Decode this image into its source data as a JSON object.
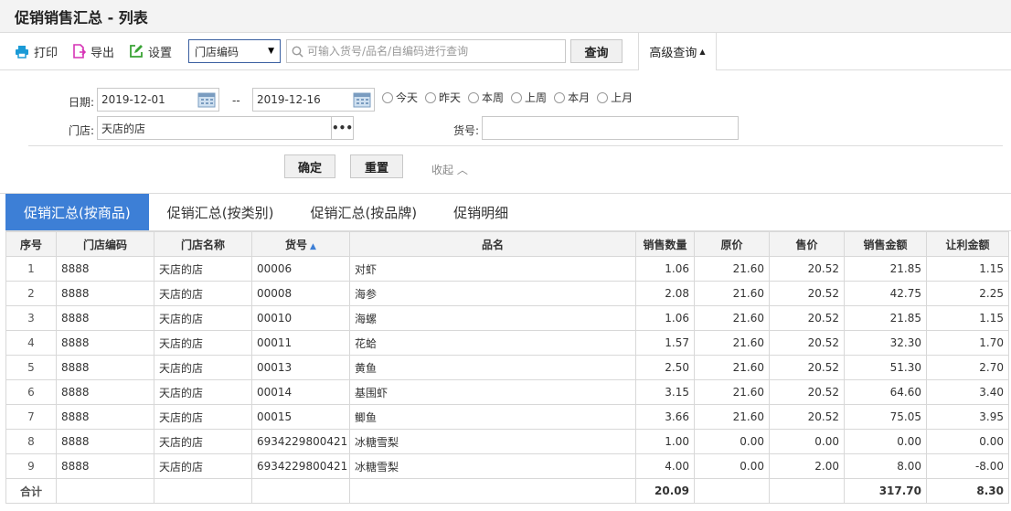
{
  "title": "促销销售汇总 - 列表",
  "toolbar": {
    "print": "打印",
    "export": "导出",
    "settings": "设置",
    "select_value": "门店编码",
    "search_placeholder": "可输入货号/品名/自编码进行查询",
    "query": "查询",
    "advanced": "高级查询"
  },
  "filter": {
    "date_label": "日期:",
    "date_from": "2019-12-01",
    "date_sep": "--",
    "date_to": "2019-12-16",
    "quick": [
      "今天",
      "昨天",
      "本周",
      "上周",
      "本月",
      "上月"
    ],
    "store_label": "门店:",
    "store_value": "天店的店",
    "sku_label": "货号:",
    "sku_value": "",
    "ok": "确定",
    "reset": "重置",
    "collapse": "收起"
  },
  "tabs": [
    "促销汇总(按商品)",
    "促销汇总(按类别)",
    "促销汇总(按品牌)",
    "促销明细"
  ],
  "table": {
    "headers": [
      "序号",
      "门店编码",
      "门店名称",
      "货号",
      "品名",
      "销售数量",
      "原价",
      "售价",
      "销售金额",
      "让利金额"
    ],
    "rows": [
      [
        "1",
        "8888",
        "天店的店",
        "00006",
        "对虾",
        "1.06",
        "21.60",
        "20.52",
        "21.85",
        "1.15"
      ],
      [
        "2",
        "8888",
        "天店的店",
        "00008",
        "海参",
        "2.08",
        "21.60",
        "20.52",
        "42.75",
        "2.25"
      ],
      [
        "3",
        "8888",
        "天店的店",
        "00010",
        "海螺",
        "1.06",
        "21.60",
        "20.52",
        "21.85",
        "1.15"
      ],
      [
        "4",
        "8888",
        "天店的店",
        "00011",
        "花蛤",
        "1.57",
        "21.60",
        "20.52",
        "32.30",
        "1.70"
      ],
      [
        "5",
        "8888",
        "天店的店",
        "00013",
        "黄鱼",
        "2.50",
        "21.60",
        "20.52",
        "51.30",
        "2.70"
      ],
      [
        "6",
        "8888",
        "天店的店",
        "00014",
        "基围虾",
        "3.15",
        "21.60",
        "20.52",
        "64.60",
        "3.40"
      ],
      [
        "7",
        "8888",
        "天店的店",
        "00015",
        "鲫鱼",
        "3.66",
        "21.60",
        "20.52",
        "75.05",
        "3.95"
      ],
      [
        "8",
        "8888",
        "天店的店",
        "6934229800421",
        "冰糖雪梨",
        "1.00",
        "0.00",
        "0.00",
        "0.00",
        "0.00"
      ],
      [
        "9",
        "8888",
        "天店的店",
        "6934229800421",
        "冰糖雪梨",
        "4.00",
        "0.00",
        "2.00",
        "8.00",
        "-8.00"
      ]
    ],
    "total": [
      "合计",
      "",
      "",
      "",
      "",
      "20.09",
      "",
      "",
      "317.70",
      "8.30"
    ]
  }
}
